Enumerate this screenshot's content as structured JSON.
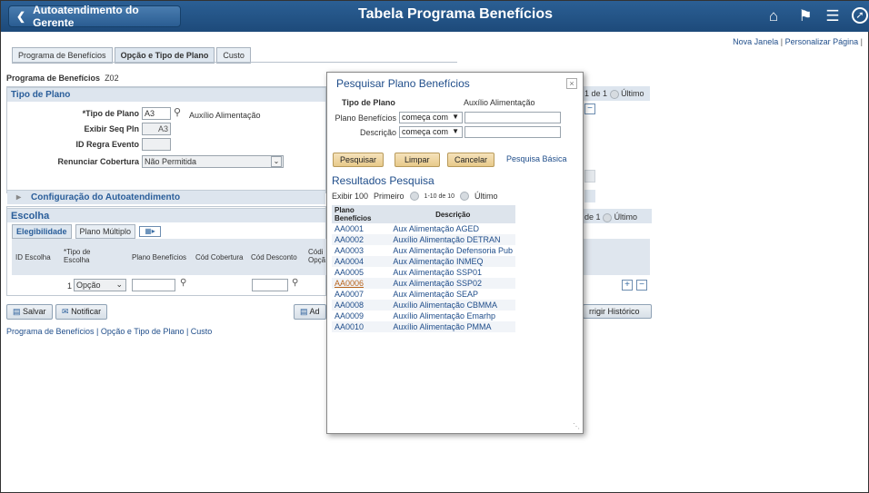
{
  "banner": {
    "back_label": "Autoatendimento do Gerente",
    "title": "Tabela Programa Benefícios",
    "icons": [
      "home-icon",
      "flag-icon",
      "menu-icon",
      "compass-icon"
    ]
  },
  "top_links": {
    "new_window": "Nova Janela",
    "personalize": "Personalizar Página"
  },
  "tabs": [
    "Programa de Benefícios",
    "Opção e Tipo de Plano",
    "Custo"
  ],
  "form": {
    "program_label": "Programa de Benefícios",
    "program_value": "Z02",
    "plan_type_section": "Tipo de Plano",
    "plan_type_label": "*Tipo de Plano",
    "plan_type_value": "A3",
    "plan_type_desc": "Auxílio Alimentação",
    "seq_label": "Exibir Seq Pln",
    "seq_value": "A3",
    "event_rule_label": "ID Regra Evento",
    "waive_label": "Renunciar Cobertura",
    "waive_value": "Não Permitida",
    "self_service_section": "Configuração do Autoatendimento",
    "choice_section": "Escolha",
    "choice_tabs": [
      "Elegibilidade",
      "Plano Múltiplo"
    ],
    "grid_headers": [
      "ID Escolha",
      "*Tipo de Escolha",
      "Plano Benefícios",
      "Cód Cobertura",
      "Cód Desconto",
      "Códi Opçã"
    ],
    "row_id": "1",
    "row_type": "Opção",
    "paging_right_top": "1 de 1",
    "paging_right_mid": "de 1",
    "last": "Último",
    "save": "Salvar",
    "notify": "Notificar",
    "add_partial": "Ad",
    "correct_history": "rrigir Histórico"
  },
  "bottom_links": "Programa de Benefícios | Opção e Tipo de Plano | Custo",
  "modal": {
    "title": "Pesquisar Plano Benefícios",
    "close": "×",
    "plan_type_label": "Tipo de Plano",
    "plan_type_value": "Auxílio Alimentação",
    "field1_label": "Plano Benefícios",
    "field2_label": "Descrição",
    "operator": "começa com",
    "search_btn": "Pesquisar",
    "clear_btn": "Limpar",
    "cancel_btn": "Cancelar",
    "basic_search": "Pesquisa Básica",
    "results_title": "Resultados Pesquisa",
    "show": "Exibir 100",
    "first": "Primeiro",
    "range": "1-10 de 10",
    "last": "Último",
    "columns": [
      "Plano Benefícios",
      "Descrição"
    ],
    "rows": [
      {
        "code": "AA0001",
        "desc": "Aux Alimentação AGED"
      },
      {
        "code": "AA0002",
        "desc": "Auxílio Alimentação DETRAN"
      },
      {
        "code": "AA0003",
        "desc": "Aux Alimentação Defensoria Pub"
      },
      {
        "code": "AA0004",
        "desc": "Aux Alimentação INMEQ"
      },
      {
        "code": "AA0005",
        "desc": "Aux Alimentação SSP01"
      },
      {
        "code": "AA0006",
        "desc": "Aux Alimentação SSP02"
      },
      {
        "code": "AA0007",
        "desc": "Aux Alimentação SEAP"
      },
      {
        "code": "AA0008",
        "desc": "Auxílio Alimentação CBMMA"
      },
      {
        "code": "AA0009",
        "desc": "Auxílio Alimentação Emarhp"
      },
      {
        "code": "AA0010",
        "desc": "Auxílio Alimentação PMMA"
      }
    ]
  }
}
